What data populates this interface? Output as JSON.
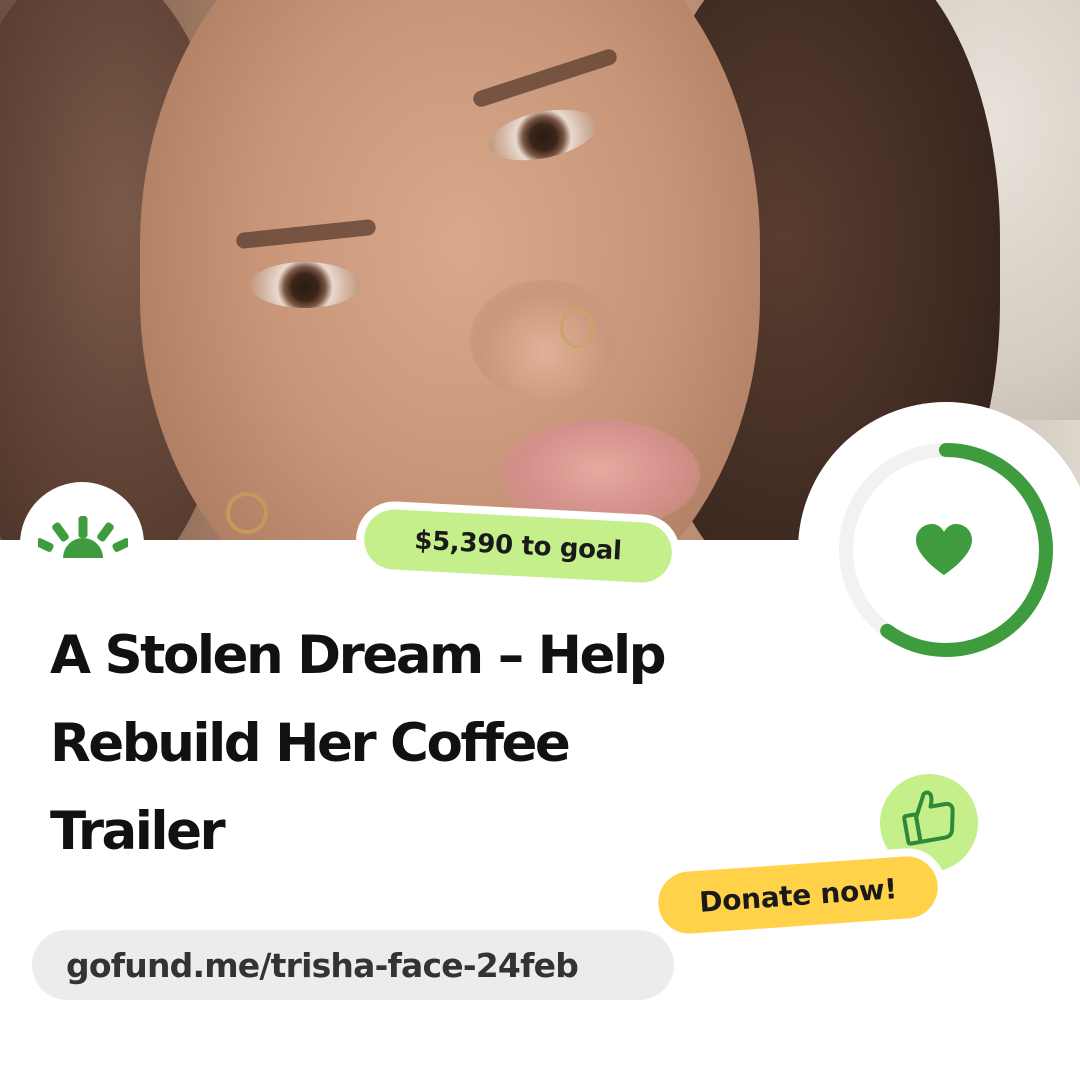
{
  "campaign": {
    "goal_badge": "$5,390 to goal",
    "title_lines": [
      "A Stolen Dream – Help",
      "Rebuild Her Coffee",
      "Trailer"
    ],
    "donate_label": "Donate now!",
    "url": "gofund.me/trisha-face-24feb"
  },
  "progress": {
    "fraction": 0.6
  },
  "icons": {
    "brand_logo": "sunrise-logo-icon",
    "progress_center": "heart-icon",
    "like": "thumbs-up-icon"
  },
  "colors": {
    "brand_green": "#3e9b3e",
    "lime": "#c4ef8a",
    "yellow": "#ffd24a",
    "track": "#f2f2f2",
    "url_pill": "#ececec"
  }
}
